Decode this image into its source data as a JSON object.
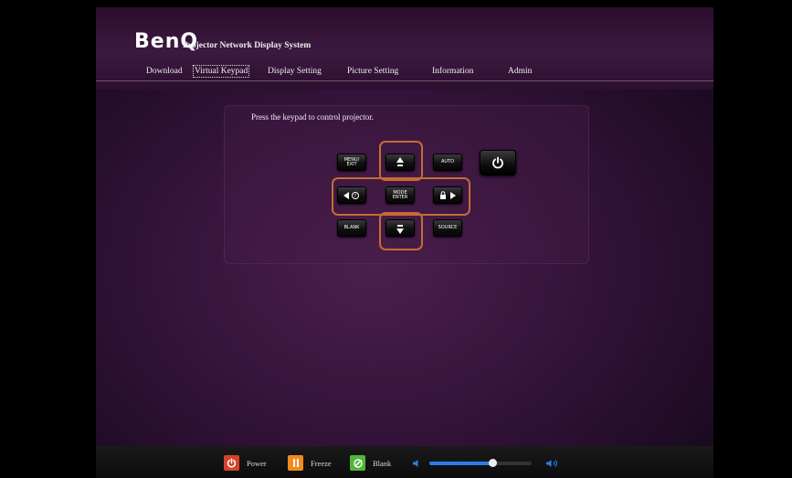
{
  "header": {
    "logo": "BenQ",
    "system_title": "Projector Network Display System"
  },
  "nav": {
    "items": [
      {
        "label": "Download"
      },
      {
        "label": "Virtual Keypad"
      },
      {
        "label": "Display Setting"
      },
      {
        "label": "Picture Setting"
      },
      {
        "label": "Information"
      },
      {
        "label": "Admin"
      }
    ],
    "active": "Virtual Keypad"
  },
  "keypad": {
    "instruction": "Press the keypad to control projector.",
    "keys": {
      "menu_exit": "MENU/\nEXIT",
      "auto": "AUTO",
      "mode_enter": "MODE\nENTER",
      "blank": "BLANK",
      "source": "SOURCE"
    },
    "icons": {
      "power": "power-icon",
      "up": "arrow-up-icon",
      "down": "arrow-down-icon",
      "left": "arrow-left-icon",
      "right": "arrow-right-icon",
      "help": "help-icon",
      "lock": "lock-icon"
    },
    "highlight_color": "#c66c32"
  },
  "footer": {
    "power_label": "Power",
    "freeze_label": "Freeze",
    "blank_label": "Blank",
    "volume_level": 0.62,
    "colors": {
      "power": "#d8412b",
      "freeze": "#f08a1d",
      "blank": "#4fb63a",
      "volume": "#2b7de9"
    }
  }
}
